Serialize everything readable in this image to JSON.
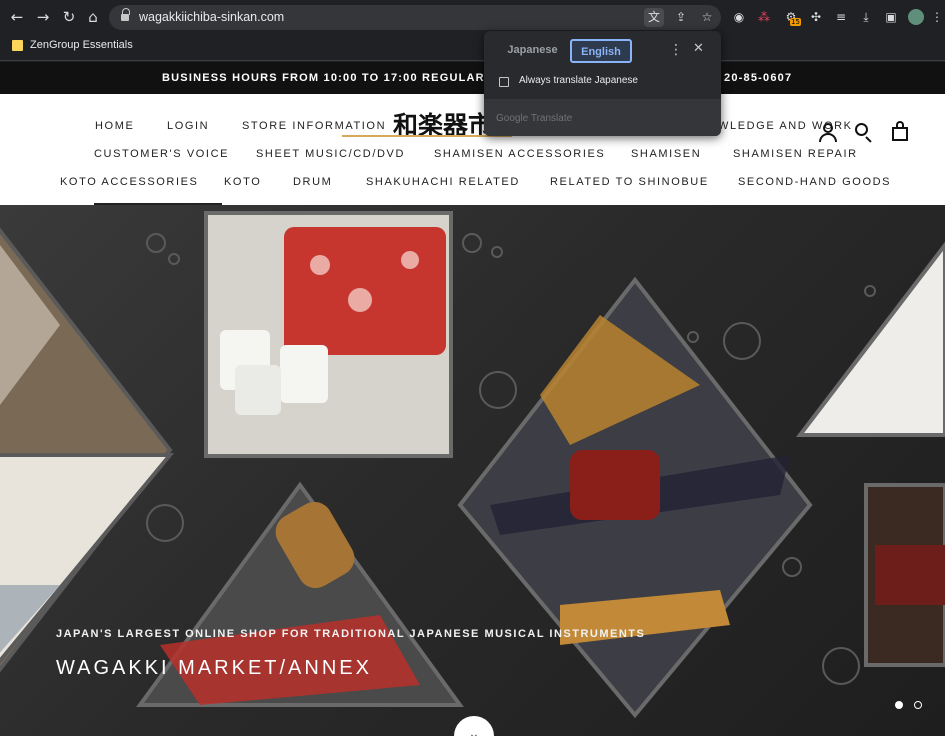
{
  "browser": {
    "url": "wagakkiichiba-sinkan.com",
    "bookmark_label": "ZenGroup Essentials",
    "extension_badge": "15"
  },
  "announcement": {
    "left_text": "BUSINESS HOURS FROM 10:00 TO 17:00 REGULAR HOL",
    "right_text": "20-85-0607"
  },
  "header": {
    "logo_text": "和楽器市",
    "nav_row1": [
      "HOME",
      "LOGIN",
      "STORE INFORMATION",
      "WLEDGE AND WORK"
    ],
    "nav_row2": [
      "CUSTOMER'S VOICE",
      "SHEET MUSIC/CD/DVD",
      "SHAMISEN ACCESSORIES",
      "SHAMISEN",
      "SHAMISEN REPAIR"
    ],
    "nav_row3": [
      "KOTO ACCESSORIES",
      "KOTO",
      "DRUM",
      "SHAKUHACHI RELATED",
      "RELATED TO SHINOBUE",
      "SECOND-HAND GOODS"
    ]
  },
  "hero": {
    "subtitle": "JAPAN'S LARGEST ONLINE SHOP FOR TRADITIONAL JAPANESE MUSICAL INSTRUMENTS",
    "title": "WAGAKKI MARKET/ANNEX",
    "slide_count": 2,
    "active_slide": 1
  },
  "translate_popup": {
    "source_tab": "Japanese",
    "target_tab": "English",
    "checkbox_label": "Always translate Japanese",
    "checkbox_checked": false,
    "footer": "Google Translate"
  },
  "colors": {
    "accent_blue": "#8ab4f8",
    "logo_gold": "#d6a85a",
    "dot_active": "#ffffff"
  }
}
